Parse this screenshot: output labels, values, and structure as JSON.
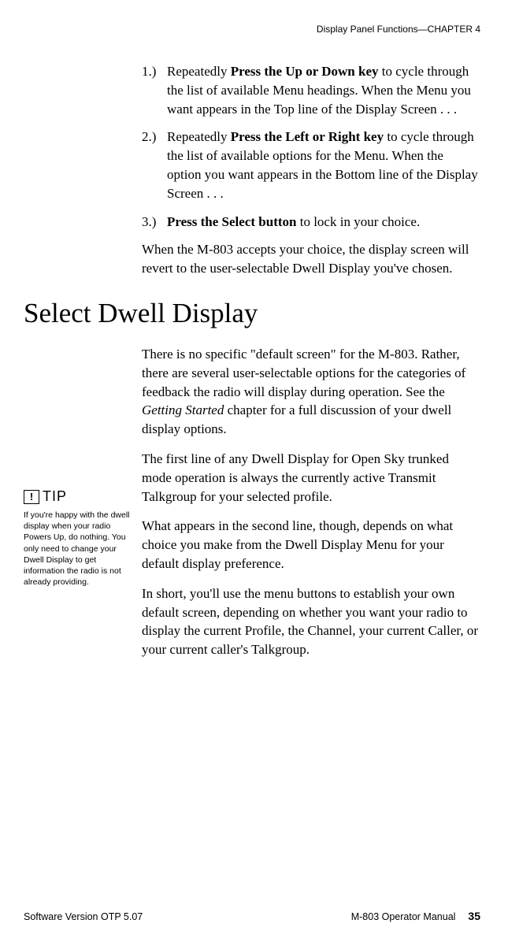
{
  "header": {
    "text": "Display Panel Functions—CHAPTER 4"
  },
  "list": {
    "item1": {
      "num": "1.)",
      "pre": "Repeatedly ",
      "bold": "Press the Up or Down key",
      "post": " to cycle through the list of available Menu headings. When the Menu you want appears in the Top line of the Display Screen . . ."
    },
    "item2": {
      "num": "2.)",
      "pre": "Repeatedly ",
      "bold": "Press the Left or Right key",
      "post": " to cycle through the list of available options for the Menu. When the option you want appears in the Bottom line of the Display Screen . . ."
    },
    "item3": {
      "num": "3.)",
      "bold": "Press the Select button",
      "post": " to lock in your choice."
    }
  },
  "para_accept": "When the M-803 accepts your choice, the display screen will revert to the user-selectable Dwell Display you've chosen.",
  "heading": "Select Dwell Display",
  "para_intro": {
    "pre": "There is no specific \"default screen\" for the M-803. Rather, there are several user-selectable options for the categories of feedback the radio will display during operation. See the ",
    "italic": "Getting Started",
    "post": " chapter for a full discussion of your dwell display options."
  },
  "para_first": "The first line of any Dwell Display for Open Sky trunked mode operation is always the currently active Transmit Talkgroup for your selected profile.",
  "para_second": "What appears in the second line, though, depends on what choice you make from the Dwell Display Menu for your default display preference.",
  "para_inshort": "In short, you'll use the menu buttons to establish your own default screen, depending on whether you want your radio to display the current Profile, the Channel, your current Caller, or your current caller's Talkgroup.",
  "tip": {
    "icon_char": "!",
    "label": "TIP",
    "text": "If you're happy with the dwell display when your radio Powers Up, do nothing. You only need to change your Dwell Display to get information the radio is not already providing."
  },
  "footer": {
    "left": "Software Version OTP 5.07",
    "manual": "M-803 Operator Manual",
    "page": "35"
  }
}
